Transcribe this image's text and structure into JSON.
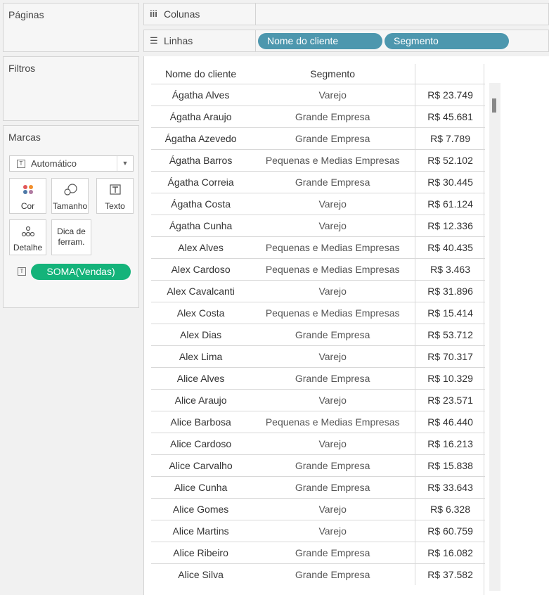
{
  "cards": {
    "pages_title": "Páginas",
    "filters_title": "Filtros",
    "marks_title": "Marcas"
  },
  "shelves": {
    "columns_label": "Colunas",
    "rows_label": "Linhas",
    "row_pills": [
      "Nome do cliente",
      "Segmento"
    ]
  },
  "marks": {
    "mark_type": "Automático",
    "buttons": {
      "color": "Cor",
      "size": "Tamanho",
      "text": "Texto",
      "detail": "Detalhe",
      "tooltip": "Dica de ferram."
    },
    "text_field_pill": "SOMA(Vendas)"
  },
  "table": {
    "headers": {
      "name": "Nome do cliente",
      "segment": "Segmento",
      "value": ""
    },
    "rows": [
      {
        "name": "Ágatha Alves",
        "segment": "Varejo",
        "value": "R$ 23.749"
      },
      {
        "name": "Ágatha Araujo",
        "segment": "Grande Empresa",
        "value": "R$ 45.681"
      },
      {
        "name": "Ágatha Azevedo",
        "segment": "Grande Empresa",
        "value": "R$ 7.789"
      },
      {
        "name": "Ágatha Barros",
        "segment": "Pequenas e Medias Empresas",
        "value": "R$ 52.102"
      },
      {
        "name": "Ágatha Correia",
        "segment": "Grande Empresa",
        "value": "R$ 30.445"
      },
      {
        "name": "Ágatha Costa",
        "segment": "Varejo",
        "value": "R$ 61.124"
      },
      {
        "name": "Ágatha Cunha",
        "segment": "Varejo",
        "value": "R$ 12.336"
      },
      {
        "name": "Alex Alves",
        "segment": "Pequenas e Medias Empresas",
        "value": "R$ 40.435"
      },
      {
        "name": "Alex Cardoso",
        "segment": "Pequenas e Medias Empresas",
        "value": "R$ 3.463"
      },
      {
        "name": "Alex Cavalcanti",
        "segment": "Varejo",
        "value": "R$ 31.896"
      },
      {
        "name": "Alex Costa",
        "segment": "Pequenas e Medias Empresas",
        "value": "R$ 15.414"
      },
      {
        "name": "Alex Dias",
        "segment": "Grande Empresa",
        "value": "R$ 53.712"
      },
      {
        "name": "Alex Lima",
        "segment": "Varejo",
        "value": "R$ 70.317"
      },
      {
        "name": "Alice Alves",
        "segment": "Grande Empresa",
        "value": "R$ 10.329"
      },
      {
        "name": "Alice Araujo",
        "segment": "Varejo",
        "value": "R$ 23.571"
      },
      {
        "name": "Alice Barbosa",
        "segment": "Pequenas e Medias Empresas",
        "value": "R$ 46.440"
      },
      {
        "name": "Alice Cardoso",
        "segment": "Varejo",
        "value": "R$ 16.213"
      },
      {
        "name": "Alice Carvalho",
        "segment": "Grande Empresa",
        "value": "R$ 15.838"
      },
      {
        "name": "Alice Cunha",
        "segment": "Grande Empresa",
        "value": "R$ 33.643"
      },
      {
        "name": "Alice Gomes",
        "segment": "Varejo",
        "value": "R$ 6.328"
      },
      {
        "name": "Alice Martins",
        "segment": "Varejo",
        "value": "R$ 60.759"
      },
      {
        "name": "Alice Ribeiro",
        "segment": "Grande Empresa",
        "value": "R$ 16.082"
      },
      {
        "name": "Alice Silva",
        "segment": "Grande Empresa",
        "value": "R$ 37.582"
      }
    ]
  },
  "colors": {
    "row_pill": "#4d97ae",
    "measure_pill": "#14b37a"
  }
}
